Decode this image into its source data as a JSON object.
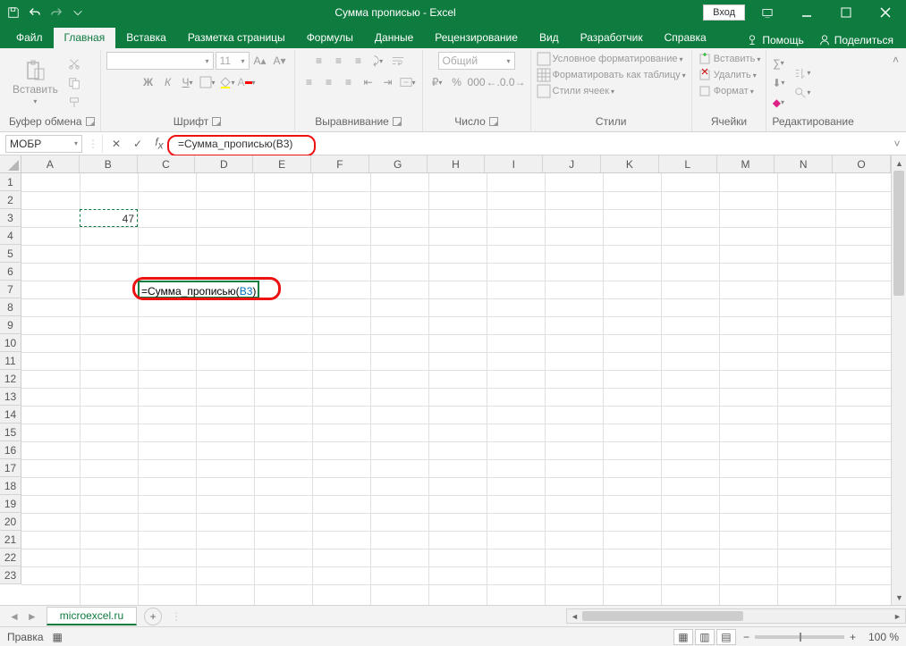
{
  "title": "Сумма прописью  -  Excel",
  "login": "Вход",
  "tabs": [
    "Файл",
    "Главная",
    "Вставка",
    "Разметка страницы",
    "Формулы",
    "Данные",
    "Рецензирование",
    "Вид",
    "Разработчик",
    "Справка"
  ],
  "activeTab": 1,
  "help": "Помощь",
  "share": "Поделиться",
  "ribbon": {
    "clipboard": {
      "label": "Буфер обмена",
      "paste": "Вставить"
    },
    "font": {
      "label": "Шрифт",
      "name": "",
      "size": "11"
    },
    "align": {
      "label": "Выравнивание"
    },
    "number": {
      "label": "Число",
      "format": "Общий"
    },
    "styles": {
      "label": "Стили",
      "cond": "Условное форматирование",
      "table": "Форматировать как таблицу",
      "cell": "Стили ячеек"
    },
    "cells": {
      "label": "Ячейки",
      "insert": "Вставить",
      "delete": "Удалить",
      "format": "Формат"
    },
    "editing": {
      "label": "Редактирование"
    }
  },
  "namebox": "МОБР",
  "formula": {
    "prefix": "=Сумма_прописью(",
    "ref": "B3",
    "suffix": ")"
  },
  "columns": [
    "A",
    "B",
    "C",
    "D",
    "E",
    "F",
    "G",
    "H",
    "I",
    "J",
    "K",
    "L",
    "M",
    "N",
    "O"
  ],
  "rows": 23,
  "cells": {
    "B3": "47"
  },
  "editCell": {
    "row": 7,
    "col": "C"
  },
  "sheet": "microexcel.ru",
  "status": "Правка",
  "zoom": "100 %"
}
